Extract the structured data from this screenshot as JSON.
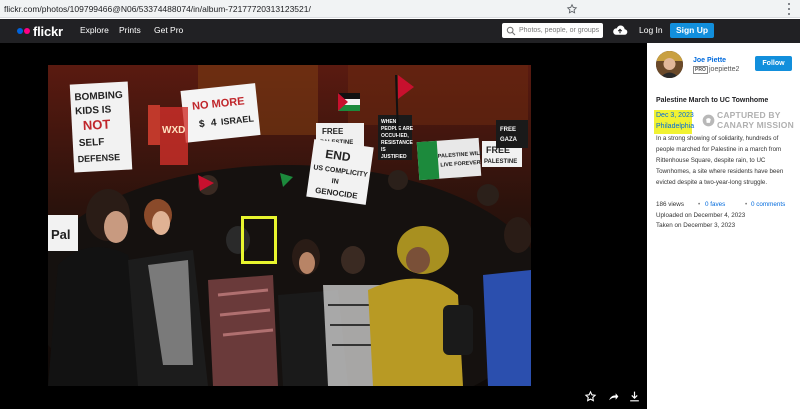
{
  "browser": {
    "url": "flickr.com/photos/109799466@N06/53374488074/in/album-72177720313123521/"
  },
  "nav": {
    "logo_text": "flickr",
    "explore": "Explore",
    "prints": "Prints",
    "get_pro": "Get Pro",
    "search_placeholder": "Photos, people, or groups",
    "login": "Log In",
    "signup": "Sign Up"
  },
  "photo": {
    "signs": {
      "s1": [
        "BOMBING",
        "KIDS IS",
        "NOT",
        "SELF",
        "DEFENSE"
      ],
      "s2": [
        "NO MORE",
        "$",
        "4",
        "ISRAEL"
      ],
      "s3": [
        "FREE",
        "PALESTINE"
      ],
      "s4": [
        "WHEN",
        "PEOPLE ARE",
        "OCCUPIED,",
        "RESISTANCE",
        "IS",
        "JUSTIFIED"
      ],
      "s5": [
        "END",
        "US COMPLICITY",
        "IN",
        "GENOCIDE"
      ],
      "s6": [
        "PALESTINE WILL",
        "LIVE FOREVER"
      ],
      "s7": [
        "FREE",
        "PALESTINE"
      ],
      "s8": [
        "FREE",
        "GAZA"
      ],
      "s9": [
        "WXD"
      ],
      "s10": [
        "Pal"
      ]
    }
  },
  "owner": {
    "name": "Joe Piette",
    "pro_badge": "PRO",
    "handle": "joepiette2",
    "follow": "Follow"
  },
  "info": {
    "title": "Palestine March to UC Townhome",
    "date": "Dec 3, 2023",
    "place": "Philadelphia",
    "stamp_line1": "CAPTURED BY",
    "stamp_line2": "CANARY MISSION",
    "description_lines": [
      "In a strong showing of solidarity, hundreds of",
      "people marched for Palestine in a march from",
      "Rittenhouse Square, despite rain, to UC",
      "Townhomes, a site where residents have been",
      "evicted despite a two-year-long struggle."
    ],
    "views": "186 views",
    "faves": "0 faves",
    "comments": "0 comments",
    "separator": "•",
    "uploaded": "Uploaded on December 4, 2023",
    "taken": "Taken on December 3, 2023"
  },
  "colors": {
    "nav_bg": "#212124",
    "signup_blue": "#128fdc",
    "link_blue": "#006add",
    "highlight_yellow": "#f1f232",
    "face_box_yellow": "#e8f52e"
  },
  "icons": [
    "star-icon",
    "menu-icon",
    "search-icon",
    "upload-cloud-icon",
    "favorite-star-icon",
    "share-icon",
    "download-icon",
    "canary-mission-logo-icon"
  ]
}
